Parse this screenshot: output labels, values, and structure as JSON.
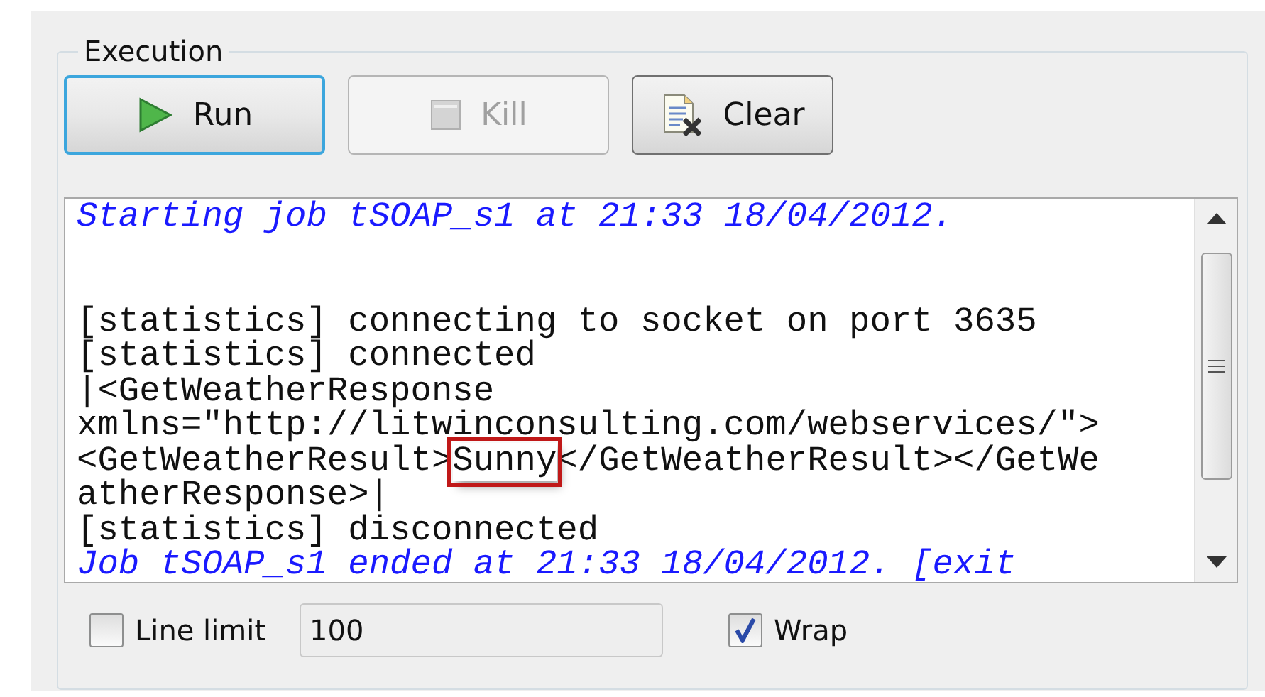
{
  "group": {
    "title": "Execution"
  },
  "buttons": [
    {
      "label": "Run",
      "kind": "run",
      "disabled": false,
      "focused": true
    },
    {
      "label": "Kill",
      "kind": "kill",
      "disabled": true,
      "focused": false
    },
    {
      "label": "Clear",
      "kind": "clear",
      "disabled": false,
      "focused": false
    }
  ],
  "console": {
    "lines": [
      {
        "kind": "info",
        "text": "Starting job tSOAP_s1 at 21:33 18/04/2012."
      },
      {
        "kind": "blank"
      },
      {
        "kind": "blank"
      },
      {
        "kind": "output",
        "text": "[statistics] connecting to socket on port 3635"
      },
      {
        "kind": "output",
        "text": "[statistics] connected"
      },
      {
        "kind": "output",
        "text": "|<GetWeatherResponse"
      },
      {
        "kind": "output",
        "text": "xmlns=\"http://litwinconsulting.com/webservices/\">"
      },
      {
        "kind": "highlighted",
        "before": "<GetWeatherResult>",
        "highlight": "Sunny",
        "after": "</GetWeatherResult></GetWe"
      },
      {
        "kind": "output",
        "text": "atherResponse>|"
      },
      {
        "kind": "output",
        "text": "[statistics] disconnected"
      },
      {
        "kind": "info",
        "text": "Job tSOAP_s1 ended at 21:33 18/04/2012. [exit"
      }
    ]
  },
  "options": {
    "line_limit": {
      "label": "Line limit",
      "checked": false,
      "value": "100"
    },
    "wrap": {
      "label": "Wrap",
      "checked": true
    }
  }
}
